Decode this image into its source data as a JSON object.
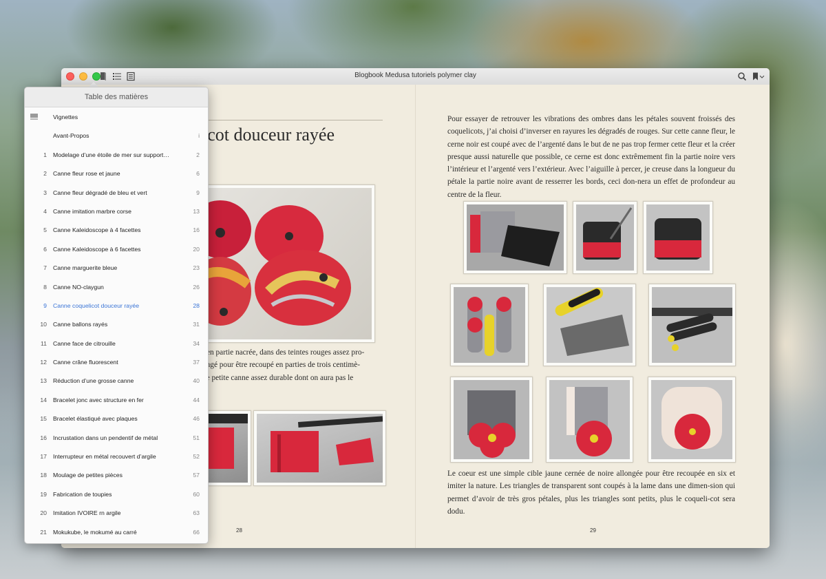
{
  "window": {
    "title": "Blogbook Medusa tutoriels polymer clay"
  },
  "toc": {
    "header": "Table des matières",
    "items": [
      {
        "num": "",
        "label": "Vignettes",
        "page": "",
        "icon": "thumbnails-icon"
      },
      {
        "num": "",
        "label": "Avant-Propos",
        "page": "i"
      },
      {
        "num": "1",
        "label": "Modelage d’une étoile de mer sur support…",
        "page": "2"
      },
      {
        "num": "2",
        "label": "Canne fleur rose et jaune",
        "page": "6"
      },
      {
        "num": "3",
        "label": "Canne fleur dégradé de bleu et vert",
        "page": "9"
      },
      {
        "num": "4",
        "label": "Canne imitation marbre corse",
        "page": "13"
      },
      {
        "num": "5",
        "label": "Canne Kaleidoscope à 4 facettes",
        "page": "16"
      },
      {
        "num": "6",
        "label": "Canne Kaleidoscope à 6 facettes",
        "page": "20"
      },
      {
        "num": "7",
        "label": "Canne marguerite bleue",
        "page": "23"
      },
      {
        "num": "8",
        "label": "Canne NO-claygun",
        "page": "26"
      },
      {
        "num": "9",
        "label": "Canne coquelicot douceur rayée",
        "page": "28",
        "active": true
      },
      {
        "num": "10",
        "label": "Canne ballons rayés",
        "page": "31"
      },
      {
        "num": "11",
        "label": "Canne face de citrouille",
        "page": "34"
      },
      {
        "num": "12",
        "label": "Canne crâne fluorescent",
        "page": "37"
      },
      {
        "num": "13",
        "label": "Réduction d’une grosse canne",
        "page": "40"
      },
      {
        "num": "14",
        "label": "Bracelet jonc avec structure en fer",
        "page": "44"
      },
      {
        "num": "15",
        "label": "Bracelet élastiqué avec plaques",
        "page": "46"
      },
      {
        "num": "16",
        "label": "Incrustation dans un pendentif de métal",
        "page": "51"
      },
      {
        "num": "17",
        "label": "Interrupteur en métal recouvert d’argile",
        "page": "52"
      },
      {
        "num": "18",
        "label": "Moulage de petites pièces",
        "page": "57"
      },
      {
        "num": "19",
        "label": "Fabrication de toupies",
        "page": "60"
      },
      {
        "num": "20",
        "label": "Imitation IVOIRE rn argile",
        "page": "63"
      },
      {
        "num": "21",
        "label": "Mokukube, le mokumé au carré",
        "page": "66"
      }
    ]
  },
  "left_page": {
    "title_fragment": "icot douceur rayée",
    "text_lines": [
      "t en partie nacrée, dans des teintes rouges assez pro-",
      "ongé pour être recoupé en parties de trois centimè-",
      "ne petite canne assez durable dont on aura pas le"
    ],
    "page_number": "28"
  },
  "right_page": {
    "paragraph1": "Pour essayer de retrouver les vibrations des ombres dans les pétales souvent froissés des coquelicots, j’ai choisi d’inverser en rayures les dégradés de rouges. Sur cette canne fleur, le cerne noir est coupé avec de l’argenté dans le but de ne pas trop fermer cette fleur et la créer presque aussi naturelle que possible, ce cerne est donc extrêmement fin la partie noire vers l’intérieur et l’argenté vers l’extérieur. Avec l’aiguille à percer, je creuse dans la longueur du pétale la partie noire avant de resserrer les bords, ceci don-nera un effet de profondeur au centre de la fleur.",
    "paragraph2": "Le coeur est une simple cible jaune cernée de noire allongée pour être recoupée en six et imiter la nature. Les triangles de transparent sont coupés à la lame dans une dimen-sion qui permet d’avoir de très gros pétales, plus les triangles sont petits, plus le coqueli-cot sera dodu.",
    "page_number": "29"
  },
  "colors": {
    "paper": "#f1ecdf",
    "accent_blue": "#3a74d6",
    "clay_red": "#d8283c",
    "clay_black": "#2a2a2a",
    "clay_silver": "#9a9a9f",
    "clay_yellow": "#e7d22a"
  }
}
